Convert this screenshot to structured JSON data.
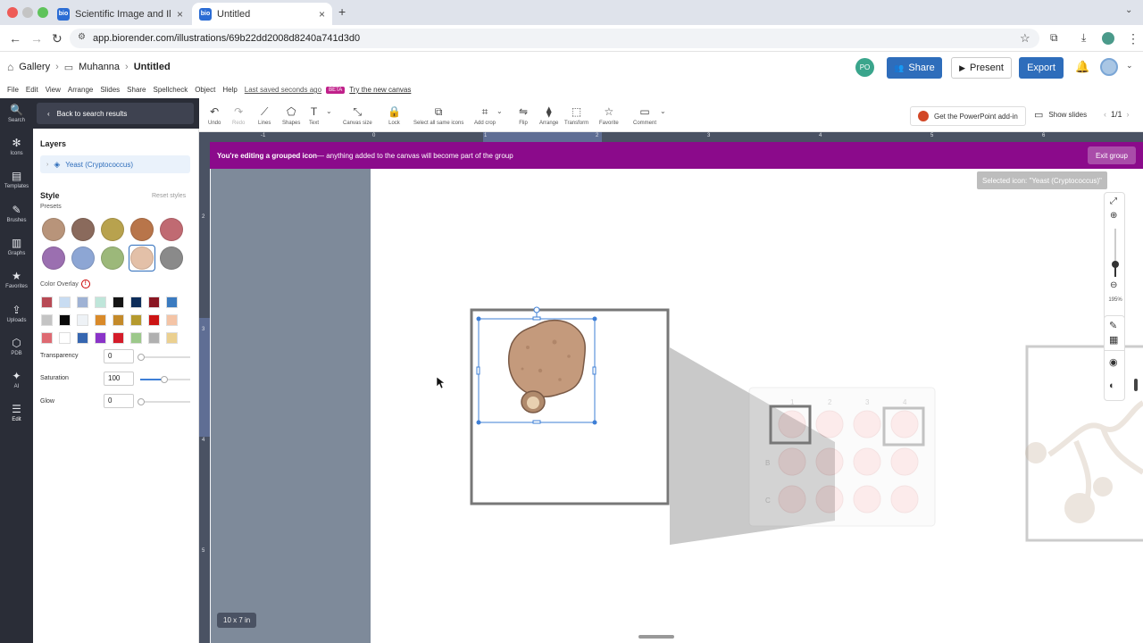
{
  "browser": {
    "tabs": [
      {
        "favicon": "bio",
        "title": "Scientific Image and Illustrati",
        "close": "×"
      },
      {
        "favicon": "bio",
        "title": "Untitled",
        "close": "×"
      }
    ],
    "new_tab": "+",
    "url": "app.biorender.com/illustrations/69b22dd2008d8240a741d3d0"
  },
  "header": {
    "gallery": "Gallery",
    "folder": "Muhanna",
    "doc_title": "Untitled",
    "avatar_initials": "PO",
    "share_label": "Share",
    "present_label": "Present",
    "export_label": "Export"
  },
  "menu": {
    "items": [
      "File",
      "Edit",
      "View",
      "Arrange",
      "Slides",
      "Share",
      "Spellcheck",
      "Object",
      "Help"
    ],
    "saved": "Last saved seconds ago",
    "beta": "BETA",
    "try_canvas": "Try the new canvas"
  },
  "toolbar": {
    "tools": [
      {
        "icon": "undo-icon",
        "glyph": "↶",
        "label": "Undo"
      },
      {
        "icon": "redo-icon",
        "glyph": "↷",
        "label": "Redo"
      },
      {
        "icon": "lines-icon",
        "glyph": "⟋",
        "label": "Lines"
      },
      {
        "icon": "shapes-icon",
        "glyph": "⬠",
        "label": "Shapes"
      },
      {
        "icon": "text-icon",
        "glyph": "T",
        "label": "Text"
      },
      {
        "icon": "canvas-size-icon",
        "glyph": "⤡",
        "label": "Canvas size"
      },
      {
        "icon": "lock-icon",
        "glyph": "🔒",
        "label": "Lock"
      },
      {
        "icon": "select-same-icon",
        "glyph": "⧉",
        "label": "Select all same icons"
      },
      {
        "icon": "crop-icon",
        "glyph": "⌗",
        "label": "Add crop"
      },
      {
        "icon": "flip-icon",
        "glyph": "⇋",
        "label": "Flip"
      },
      {
        "icon": "arrange-icon",
        "glyph": "⧫",
        "label": "Arrange"
      },
      {
        "icon": "transform-icon",
        "glyph": "⬚",
        "label": "Transform"
      },
      {
        "icon": "favorite-icon",
        "glyph": "☆",
        "label": "Favorite"
      },
      {
        "icon": "comment-icon",
        "glyph": "▭",
        "label": "Comment"
      }
    ],
    "ppt_addin": "Get the PowerPoint add-in",
    "show_slides": "Show slides",
    "slide_counter": "1/1"
  },
  "rail": [
    {
      "icon": "search-icon",
      "glyph": "🔍",
      "label": "Search"
    },
    {
      "icon": "icons-icon",
      "glyph": "✻",
      "label": "Icons"
    },
    {
      "icon": "templates-icon",
      "glyph": "▤",
      "label": "Templates"
    },
    {
      "icon": "brushes-icon",
      "glyph": "✎",
      "label": "Brushes"
    },
    {
      "icon": "graphs-icon",
      "glyph": "▥",
      "label": "Graphs"
    },
    {
      "icon": "favorites-icon",
      "glyph": "★",
      "label": "Favorites"
    },
    {
      "icon": "uploads-icon",
      "glyph": "⇪",
      "label": "Uploads"
    },
    {
      "icon": "pdb-icon",
      "glyph": "⬡",
      "label": "PDB"
    },
    {
      "icon": "ai-icon",
      "glyph": "✦",
      "label": "AI"
    },
    {
      "icon": "edit-icon",
      "glyph": "☰",
      "label": "Edit"
    }
  ],
  "sidebar": {
    "back_label": "Back to search results",
    "layers_title": "Layers",
    "layer_item": "Yeast (Cryptococcus)",
    "style_title": "Style",
    "reset_styles": "Reset styles",
    "presets_label": "Presets",
    "presets": [
      "#b8947a",
      "#8a6a5c",
      "#b8a24e",
      "#b8754a",
      "#c06a72",
      "#9b6fb0",
      "#8da6d4",
      "#9cb87a",
      "#e3c0a8",
      "#8a8a8a"
    ],
    "selected_preset_index": 8,
    "color_overlay_label": "Color Overlay",
    "color_overlay_colors": [
      "#b84a55",
      "#c8dcf2",
      "#9fb2d4",
      "#bfe6da",
      "#151515",
      "#0d2d5a",
      "#8a1622",
      "#3b7bc0",
      "#c4c4c4",
      "#0a0a0a",
      "#eef2f6",
      "#d98a2a",
      "#c48a2a",
      "#b59a2e",
      "#cc1414",
      "#f4c4a6",
      "#de6a72",
      "#ffffff",
      "#3666b0",
      "#8a34c8",
      "#d41c2a",
      "#9cc88a",
      "#b0b0b0",
      "#ebd090"
    ],
    "transparency_label": "Transparency",
    "transparency_value": "0",
    "saturation_label": "Saturation",
    "saturation_value": "100",
    "glow_label": "Glow",
    "glow_value": "0"
  },
  "canvas": {
    "ruler_labels": [
      "-1",
      "0",
      "1",
      "2",
      "3",
      "4",
      "5",
      "6"
    ],
    "ruler_left_labels": [
      "2",
      "3",
      "4",
      "5"
    ],
    "banner_bold": "You're editing a grouped icon",
    "banner_rest": " — anything added to the canvas will become part of the group",
    "exit_group": "Exit group",
    "selected_icon_label": "Selected icon: \"Yeast (Cryptococcus)\"",
    "zoom_level": "195%",
    "size_tag": "10 x 7 in",
    "plate_cols": [
      "1",
      "2",
      "3",
      "4"
    ],
    "plate_rows": [
      "B",
      "C"
    ]
  }
}
